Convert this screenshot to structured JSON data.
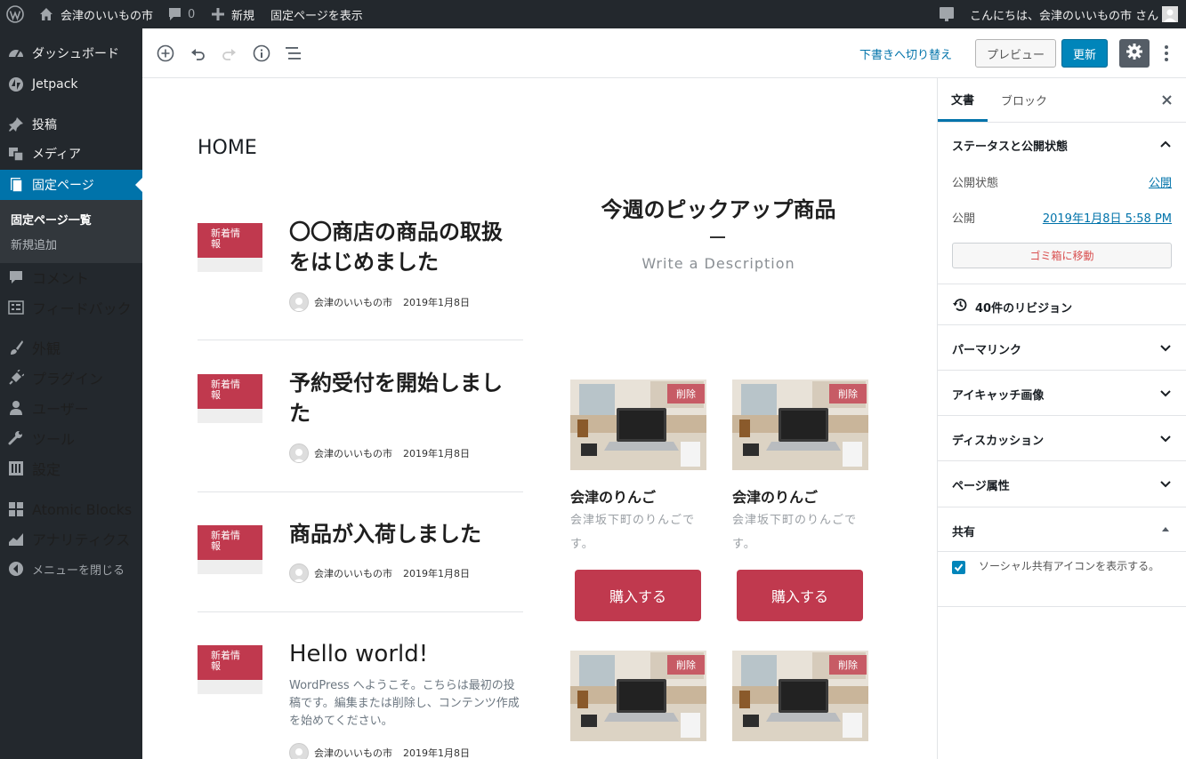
{
  "adminbar": {
    "site_name": "会津のいいもの市",
    "comments_count": "0",
    "new_label": "新規",
    "view_page_label": "固定ページを表示",
    "greeting": "こんにちは、会津のいいもの市 さん"
  },
  "sidebar": {
    "items": [
      {
        "label": "ダッシュボード",
        "icon": "dashboard-icon"
      },
      {
        "label": "Jetpack",
        "icon": "jetpack-icon"
      },
      {
        "label": "投稿",
        "icon": "pin-icon"
      },
      {
        "label": "メディア",
        "icon": "media-icon"
      },
      {
        "label": "固定ページ",
        "icon": "page-icon"
      },
      {
        "label": "コメント",
        "icon": "comment-icon"
      },
      {
        "label": "フィードバック",
        "icon": "feedback-icon"
      },
      {
        "label": "外観",
        "icon": "brush-icon"
      },
      {
        "label": "プラグイン",
        "icon": "plugin-icon"
      },
      {
        "label": "ユーザー",
        "icon": "user-icon"
      },
      {
        "label": "ツール",
        "icon": "wrench-icon"
      },
      {
        "label": "設定",
        "icon": "settings-icon"
      },
      {
        "label": "Atomic Blocks",
        "icon": "blocks-icon"
      },
      {
        "label": "アナリティクス",
        "icon": "analytics-icon"
      },
      {
        "label": "メニューを閉じる",
        "icon": "collapse-icon"
      }
    ],
    "submenu": [
      "固定ページ一覧",
      "新規追加"
    ],
    "active_color": "#0073aa"
  },
  "toolbar": {
    "draft_label": "下書きへ切り替え",
    "preview_label": "プレビュー",
    "update_label": "更新"
  },
  "canvas": {
    "page_title": "HOME",
    "posts": [
      {
        "badge": "新着情報",
        "title": "〇〇商店の商品の取扱をはじめました",
        "author": "会津のいいもの市",
        "date": "2019年1月8日"
      },
      {
        "badge": "新着情報",
        "title": "予約受付を開始しました",
        "author": "会津のいいもの市",
        "date": "2019年1月8日"
      },
      {
        "badge": "新着情報",
        "title": "商品が入荷しました",
        "author": "会津のいいもの市",
        "date": "2019年1月8日"
      },
      {
        "badge": "新着情報",
        "title": "Hello world!",
        "excerpt": "WordPress へようこそ。こちらは最初の投稿です。編集または削除し、コンテンツ作成を始めてください。",
        "author": "会津のいいもの市",
        "date": "2019年1月8日"
      }
    ],
    "pickup_title": "今週のピックアップ商品",
    "pickup_desc": "Write a Description",
    "products": [
      {
        "delete": "削除",
        "name": "会津のりんご",
        "desc": "会津坂下町のりんごです。",
        "button": "購入する"
      },
      {
        "delete": "削除",
        "name": "会津のりんご",
        "desc": "会津坂下町のりんごです。",
        "button": "購入する"
      },
      {
        "delete": "削除"
      },
      {
        "delete": "削除"
      }
    ],
    "accent": "#c0394e"
  },
  "settings": {
    "tab_doc": "文書",
    "tab_block": "ブロック",
    "status_heading": "ステータスと公開状態",
    "visibility_label": "公開状態",
    "visibility_value": "公開",
    "publish_label": "公開",
    "publish_value": "2019年1月8日 5:58 PM",
    "trash_label": "ゴミ箱に移動",
    "revisions_label": "40件のリビジョン",
    "permalink_label": "パーマリンク",
    "featured_image_label": "アイキャッチ画像",
    "discussion_label": "ディスカッション",
    "page_attributes_label": "ページ属性",
    "share_heading": "共有",
    "share_checkbox_label": "ソーシャル共有アイコンを表示する。",
    "share_checked": true
  }
}
